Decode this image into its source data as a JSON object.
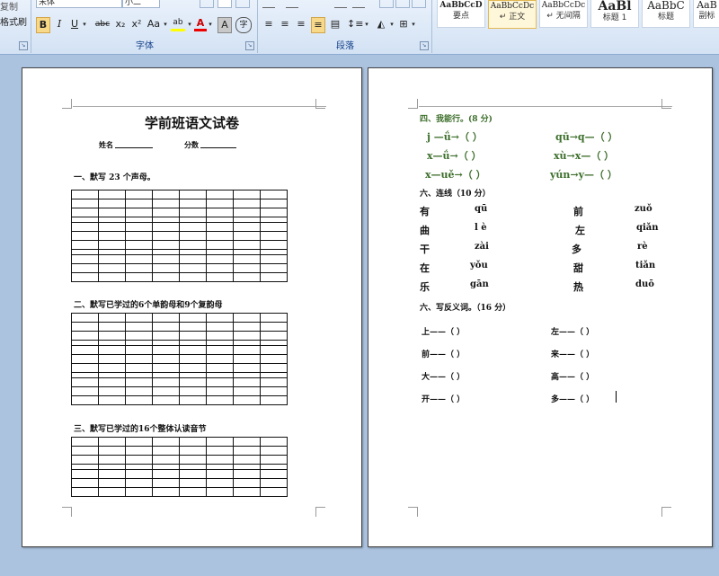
{
  "ribbon": {
    "clipboard": {
      "copy": "复制",
      "format_painter": "格式刷"
    },
    "font": {
      "label": "字体",
      "font_name": "宋体",
      "font_size": "小二",
      "bold": "B",
      "italic": "I",
      "underline": "U",
      "strike": "abc",
      "subscript": "x₂",
      "superscript": "x²",
      "change_case": "Aa",
      "highlight": "ab",
      "font_color": "A",
      "char_shading": "A",
      "enclose": "字"
    },
    "paragraph": {
      "label": "段落"
    },
    "styles": {
      "items": [
        {
          "preview": "AaBbCcD",
          "name": "要点"
        },
        {
          "preview": "AaBbCcDc",
          "name": "↵ 正文"
        },
        {
          "preview": "AaBbCcDc",
          "name": "↵ 无间隔"
        },
        {
          "preview": "AaBl",
          "name": "标题 1"
        },
        {
          "preview": "AaBbC",
          "name": "标题"
        },
        {
          "preview": "AaB",
          "name": "副标"
        }
      ]
    }
  },
  "page1": {
    "title": "学前班语文试卷",
    "name_label": "姓名",
    "score_label": "分数",
    "section1": "一、默写 23 个声母。",
    "section2": "二、默写已学过的6个单韵母和9个复韵母",
    "section3": "三、默写已学过的16个整体认读音节"
  },
  "page2": {
    "section4": "四、我能行。(8 分)",
    "pinyin_rows": [
      {
        "left": "j —ǘ→（        ）",
        "right": "qū→q—（    ）"
      },
      {
        "left": "x—ǘ→（        ）",
        "right": "xù→x—（    ）"
      },
      {
        "left": "x—uě→（        ）",
        "right": "yún→y—（    ）"
      }
    ],
    "section_link": "六、连线（10 分）",
    "link_rows": [
      {
        "c1": "有",
        "p1": "qū",
        "c2": "前",
        "p2": "zuǒ"
      },
      {
        "c1": "曲",
        "p1": "l è",
        "c2": "左",
        "p2": "qiǎn"
      },
      {
        "c1": "干",
        "p1": "zài",
        "c2": "多",
        "p2": "rè"
      },
      {
        "c1": "在",
        "p1": "yǒu",
        "c2": "甜",
        "p2": "tiǎn"
      },
      {
        "c1": "乐",
        "p1": "gān",
        "c2": "热",
        "p2": "duō"
      }
    ],
    "section_antonym": "六、写反义词。（16 分）",
    "antonym_rows": [
      {
        "left": "上——（     ）",
        "right": "左——（     ）"
      },
      {
        "left": "前——（     ）",
        "right": "来——（     ）"
      },
      {
        "left": "大——（     ）",
        "right": "高——（     ）"
      },
      {
        "left": "开——（     ）",
        "right": "多——（     ）"
      }
    ]
  }
}
